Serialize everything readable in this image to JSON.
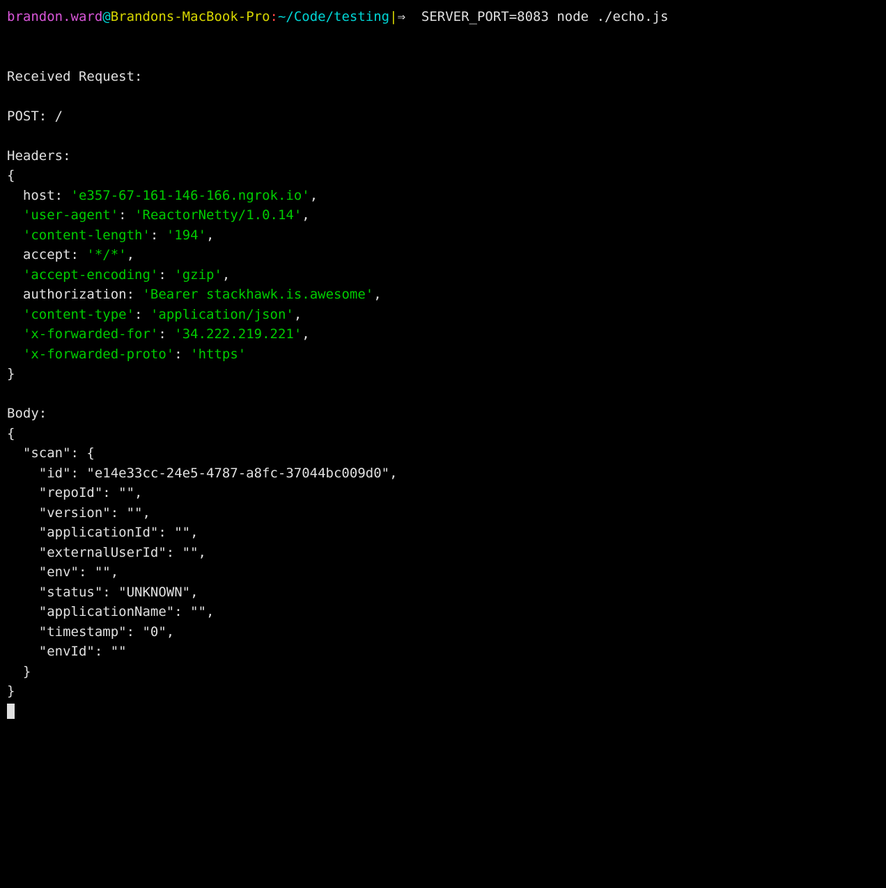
{
  "prompt": {
    "user": "brandon.ward",
    "at": "@",
    "host": "Brandons-MacBook-Pro",
    "colon": ":",
    "path": "~/Code/testing",
    "pipe": "|",
    "arrow": "⇒  ",
    "command": "SERVER_PORT=8083 node ./echo.js"
  },
  "output": {
    "received": "Received Request:",
    "method_line": "POST: /",
    "headers_label": "Headers:",
    "headers_open": "{",
    "headers": {
      "host_key": "  host:",
      "host_val": "'e357-67-161-146-166.ngrok.io'",
      "host_comma": ",",
      "ua_key": "'user-agent'",
      "ua_colon": ":",
      "ua_val": "'ReactorNetty/1.0.14'",
      "ua_comma": ",",
      "cl_key": "'content-length'",
      "cl_colon": ":",
      "cl_val": "'194'",
      "cl_comma": ",",
      "accept_key": "  accept:",
      "accept_val": "'*/*'",
      "accept_comma": ",",
      "ae_key": "'accept-encoding'",
      "ae_colon": ":",
      "ae_val": "'gzip'",
      "ae_comma": ",",
      "auth_key": "  authorization:",
      "auth_val": "'Bearer stackhawk.is.awesome'",
      "auth_comma": ",",
      "ct_key": "'content-type'",
      "ct_colon": ":",
      "ct_val": "'application/json'",
      "ct_comma": ",",
      "xff_key": "'x-forwarded-for'",
      "xff_colon": ":",
      "xff_val": "'34.222.219.221'",
      "xff_comma": ",",
      "xfp_key": "'x-forwarded-proto'",
      "xfp_colon": ":",
      "xfp_val": "'https'"
    },
    "headers_close": "}",
    "body_label": "Body:",
    "body_lines": [
      "{",
      "  \"scan\": {",
      "    \"id\": \"e14e33cc-24e5-4787-a8fc-37044bc009d0\",",
      "    \"repoId\": \"\",",
      "    \"version\": \"\",",
      "    \"applicationId\": \"\",",
      "    \"externalUserId\": \"\",",
      "    \"env\": \"\",",
      "    \"status\": \"UNKNOWN\",",
      "    \"applicationName\": \"\",",
      "    \"timestamp\": \"0\",",
      "    \"envId\": \"\"",
      "  }",
      "}"
    ]
  }
}
